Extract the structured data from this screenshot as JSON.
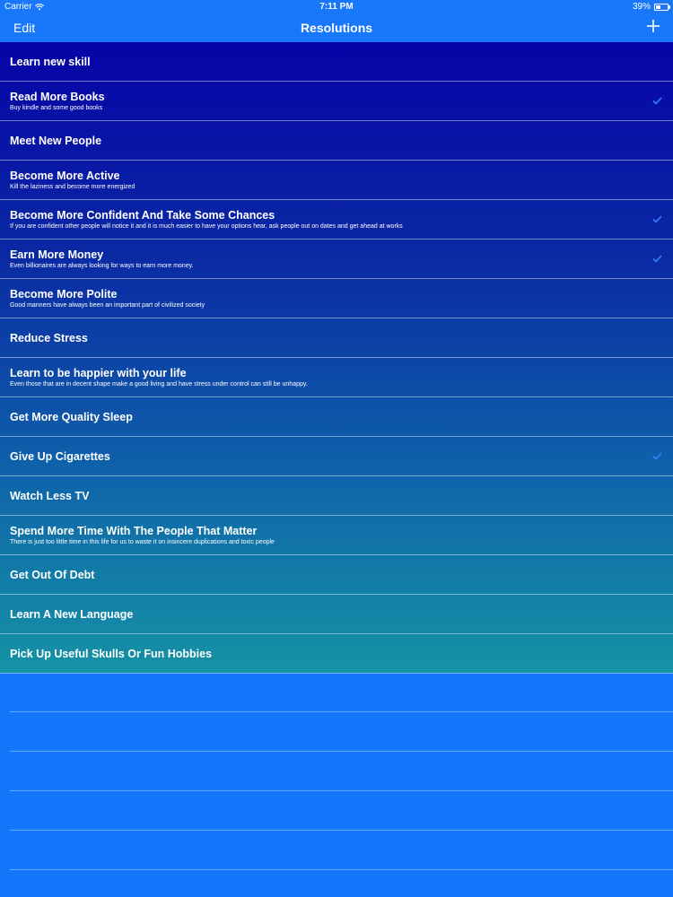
{
  "status_bar": {
    "carrier": "Carrier",
    "time": "7:11 PM",
    "battery": "39%",
    "battery_level": 0.39
  },
  "nav": {
    "edit_label": "Edit",
    "title": "Resolutions",
    "add_icon": "plus-icon"
  },
  "resolutions": [
    {
      "title": "Learn new skill",
      "subtitle": "",
      "checked": false
    },
    {
      "title": "Read More Books",
      "subtitle": "Buy kindle and some good books",
      "checked": true
    },
    {
      "title": "Meet New People",
      "subtitle": "",
      "checked": false
    },
    {
      "title": "Become More Active",
      "subtitle": "Kill the laziness and become more energized",
      "checked": false
    },
    {
      "title": "Become More Confident And Take Some Chances",
      "subtitle": "If you are confident other people will notice it and it is much easier to have your options hear, ask people out on dates and get ahead at works",
      "checked": true
    },
    {
      "title": "Earn More Money",
      "subtitle": "Even billionaires are always looking for ways to earn more money.",
      "checked": true
    },
    {
      "title": "Become More Polite",
      "subtitle": "Good manners have always been an important part of civilized society",
      "checked": false
    },
    {
      "title": "Reduce Stress",
      "subtitle": "",
      "checked": false
    },
    {
      "title": "Learn to be happier with your life",
      "subtitle": "Even those that are in decent shape make a good living and have stress under control can still be unhappy.",
      "checked": false
    },
    {
      "title": "Get More Quality Sleep",
      "subtitle": "",
      "checked": false
    },
    {
      "title": "Give Up Cigarettes",
      "subtitle": "",
      "checked": true
    },
    {
      "title": "Watch Less TV",
      "subtitle": "",
      "checked": false
    },
    {
      "title": "Spend More Time With The People That Matter",
      "subtitle": "There is just too little time in this life for us to waste it on insincere duplications and toxic people",
      "checked": false
    },
    {
      "title": "Get Out Of Debt",
      "subtitle": "",
      "checked": false
    },
    {
      "title": "Learn A New Language",
      "subtitle": "",
      "checked": false
    },
    {
      "title": "Pick Up Useful Skulls Or Fun Hobbies",
      "subtitle": "",
      "checked": false
    }
  ],
  "colors": {
    "accent": "#1877fb",
    "list_top": "#0603a6",
    "list_bottom": "#1592a4",
    "checkmark": "#2f86ff"
  }
}
